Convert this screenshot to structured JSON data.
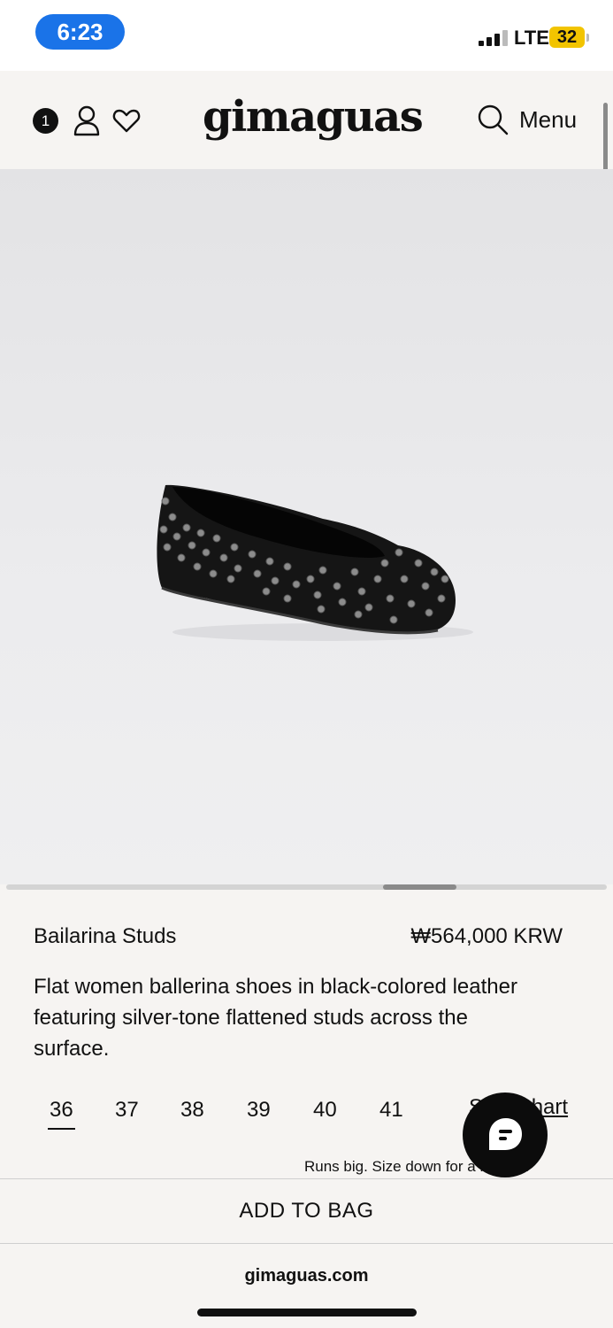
{
  "status_bar": {
    "time": "6:23",
    "network": "LTE",
    "battery": "32",
    "colors": {
      "time_pill": "#1a73e8",
      "battery": "#f2c400"
    }
  },
  "header": {
    "cart_count": "1",
    "logo": "gimaguas",
    "menu_label": "Menu",
    "icons": [
      "user-icon",
      "heart-icon",
      "search-icon"
    ]
  },
  "product": {
    "image_alt_icon": "studded-ballerina-shoe",
    "name": "Bailarina Studs",
    "price": "₩564,000 KRW",
    "description": "Flat women ballerina shoes in black-colored leather featuring silver-tone flattened studs across the surface.",
    "sizes": [
      "36",
      "37",
      "38",
      "39",
      "40",
      "41"
    ],
    "selected_size": "36",
    "size_chart_label": "Size Chart",
    "fit_note": "Runs big. Size down for a right fit."
  },
  "actions": {
    "add_to_bag_label": "ADD TO BAG"
  },
  "browser": {
    "url": "gimaguas.com"
  }
}
